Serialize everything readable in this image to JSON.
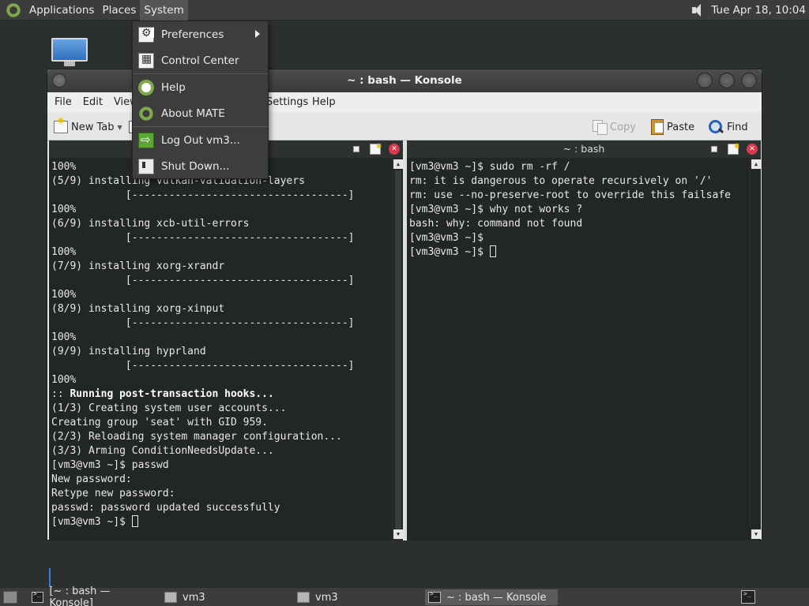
{
  "top_panel": {
    "menus": [
      "Applications",
      "Places",
      "System"
    ],
    "clock": "Tue Apr 18, 10:04",
    "icons": {
      "logo": "mate-logo-icon",
      "volume": "volume-icon"
    }
  },
  "system_menu": {
    "items": [
      {
        "label": "Preferences",
        "icon": "preferences-icon",
        "has_submenu": true
      },
      {
        "label": "Control Center",
        "icon": "control-center-icon"
      },
      {
        "label": "Help",
        "icon": "help-icon"
      },
      {
        "label": "About MATE",
        "icon": "mate-logo-icon"
      },
      {
        "label": "Log Out vm3...",
        "icon": "log-out-icon"
      },
      {
        "label": "Shut Down...",
        "icon": "shutdown-icon"
      }
    ]
  },
  "konsole": {
    "title": "~ : bash — Konsole",
    "menu": [
      "File",
      "Edit",
      "View",
      "Settings",
      "Help"
    ],
    "toolbar": {
      "new_tab": "New Tab",
      "copy": "Copy",
      "paste": "Paste",
      "find": "Find"
    },
    "left_pane": {
      "title": "",
      "lines": [
        "100%",
        "(5/9) installing vulkan-validation-layers",
        "            [-----------------------------------]",
        "100%",
        "(6/9) installing xcb-util-errors",
        "            [-----------------------------------]",
        "100%",
        "(7/9) installing xorg-xrandr",
        "            [-----------------------------------]",
        "100%",
        "(8/9) installing xorg-xinput",
        "            [-----------------------------------]",
        "100%",
        "(9/9) installing hyprland",
        "            [-----------------------------------]",
        "100%",
        ":: Running post-transaction hooks...",
        "(1/3) Creating system user accounts...",
        "Creating group 'seat' with GID 959.",
        "(2/3) Reloading system manager configuration...",
        "(3/3) Arming ConditionNeedsUpdate...",
        "[vm3@vm3 ~]$ passwd",
        "New password:",
        "Retype new password:",
        "passwd: password updated successfully",
        "[vm3@vm3 ~]$ "
      ]
    },
    "right_pane": {
      "title": "~ : bash",
      "lines": [
        "[vm3@vm3 ~]$ sudo rm -rf /",
        "rm: it is dangerous to operate recursively on '/'",
        "rm: use --no-preserve-root to override this failsafe",
        "[vm3@vm3 ~]$ why not works ?",
        "bash: why: command not found",
        "[vm3@vm3 ~]$",
        "[vm3@vm3 ~]$ "
      ]
    }
  },
  "taskbar": {
    "tasks": [
      {
        "label": "[~ : bash — Konsole]",
        "icon": "terminal-icon"
      },
      {
        "label": "vm3",
        "icon": "home-folder-icon"
      },
      {
        "label": "vm3",
        "icon": "home-folder-icon"
      },
      {
        "label": "~ : bash — Konsole",
        "icon": "terminal-icon",
        "active": true
      }
    ]
  },
  "colors": {
    "terminal_bg": "#232627",
    "panel_bg": "#3c3c3c",
    "mate_green": "#7fa84a",
    "close_red": "#d9394a"
  }
}
